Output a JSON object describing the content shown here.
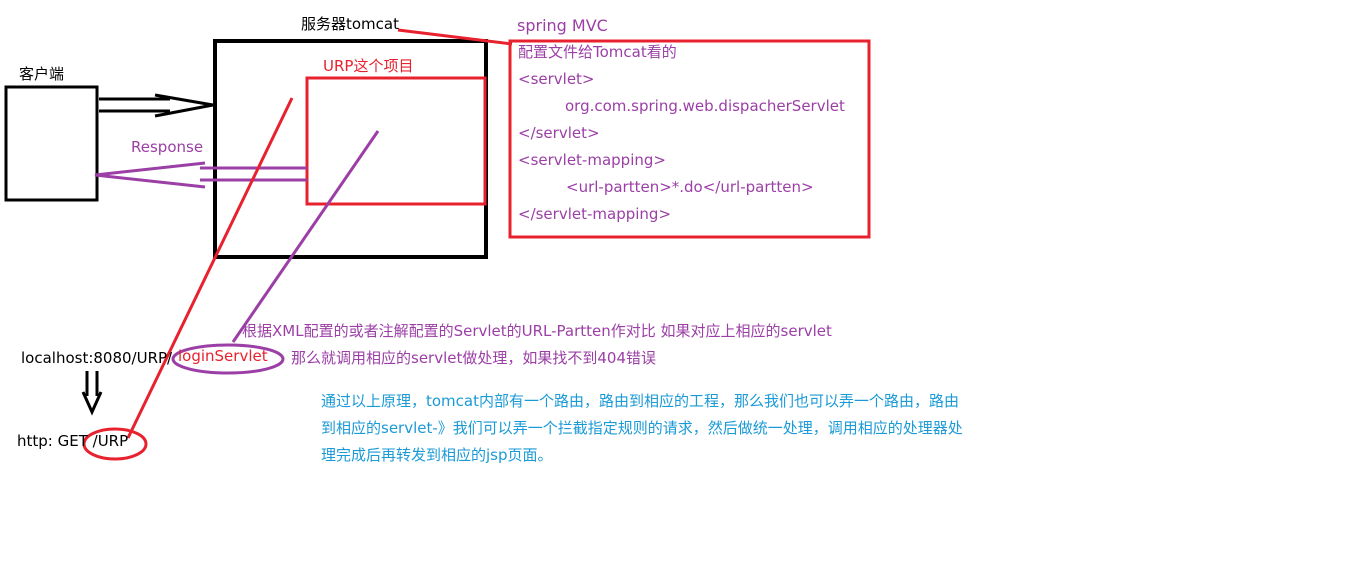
{
  "labels": {
    "server": "服务器tomcat",
    "client": "客户端",
    "project": "URP这个项目",
    "response": "Response",
    "localhost": "localhost:8080/URP/",
    "login_servlet": "loginServlet",
    "http_get": "http: GET /URP"
  },
  "config": {
    "title": "spring MVC",
    "lines": [
      "配置文件给Tomcat看的",
      "<servlet>",
      "org.com.spring.web.dispacherServlet",
      "</servlet>",
      "<servlet-mapping>",
      "<url-partten>*.do</url-partten>",
      "</servlet-mapping>"
    ]
  },
  "notes": {
    "compare_line1": "根据XML配置的或者注解配置的Servlet的URL-Partten作对比 如果对应上相应的servlet",
    "compare_line2": "那么就调用相应的servlet做处理，如果找不到404错误",
    "principle_line1": "通过以上原理，tomcat内部有一个路由，路由到相应的工程，那么我们也可以弄一个路由，路由",
    "principle_line2": "到相应的servlet-》我们可以弄一个拦截指定规则的请求，然后做统一处理，调用相应的处理器处",
    "principle_line3": "理完成后再转发到相应的jsp页面。"
  },
  "colors": {
    "black": "#000000",
    "red": "#e8212e",
    "purple": "#9b3fa6",
    "blue": "#1a9ad6"
  }
}
